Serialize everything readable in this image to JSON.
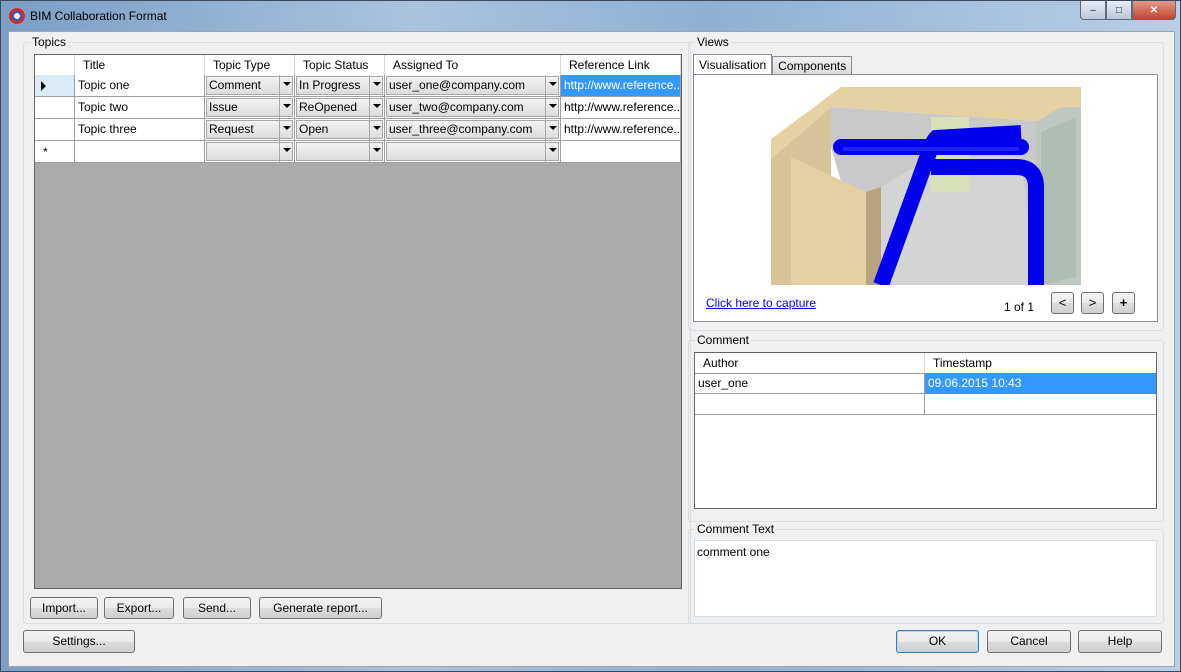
{
  "window": {
    "title": "BIM Collaboration Format",
    "buttons": {
      "minimize": "–",
      "maximize": "□",
      "close": "✕"
    }
  },
  "topics": {
    "label": "Topics",
    "columns": [
      "Title",
      "Topic Type",
      "Topic Status",
      "Assigned To",
      "Reference Link"
    ],
    "rows": [
      {
        "title": "Topic one",
        "type": "Comment",
        "status": "In Progress",
        "assigned": "user_one@company.com",
        "link": "http://www.reference..."
      },
      {
        "title": "Topic two",
        "type": "Issue",
        "status": "ReOpened",
        "assigned": "user_two@company.com",
        "link": "http://www.reference..."
      },
      {
        "title": "Topic three",
        "type": "Request",
        "status": "Open",
        "assigned": "user_three@company.com",
        "link": "http://www.reference..."
      }
    ],
    "new_row_marker": "*",
    "buttons": {
      "import": "Import...",
      "export": "Export...",
      "send": "Send...",
      "report": "Generate report..."
    }
  },
  "views": {
    "label": "Views",
    "tabs": [
      "Visualisation",
      "Components"
    ],
    "capture_link": "Click here to capture",
    "pager": "1 of 1",
    "prev": "<",
    "next": ">",
    "add": "+"
  },
  "comment": {
    "label": "Comment",
    "columns": [
      "Author",
      "Timestamp"
    ],
    "rows": [
      {
        "author": "user_one",
        "timestamp": "09.06.2015 10:43"
      }
    ]
  },
  "comment_text": {
    "label": "Comment Text",
    "value": "comment one"
  },
  "footer": {
    "settings": "Settings...",
    "ok": "OK",
    "cancel": "Cancel",
    "help": "Help"
  }
}
